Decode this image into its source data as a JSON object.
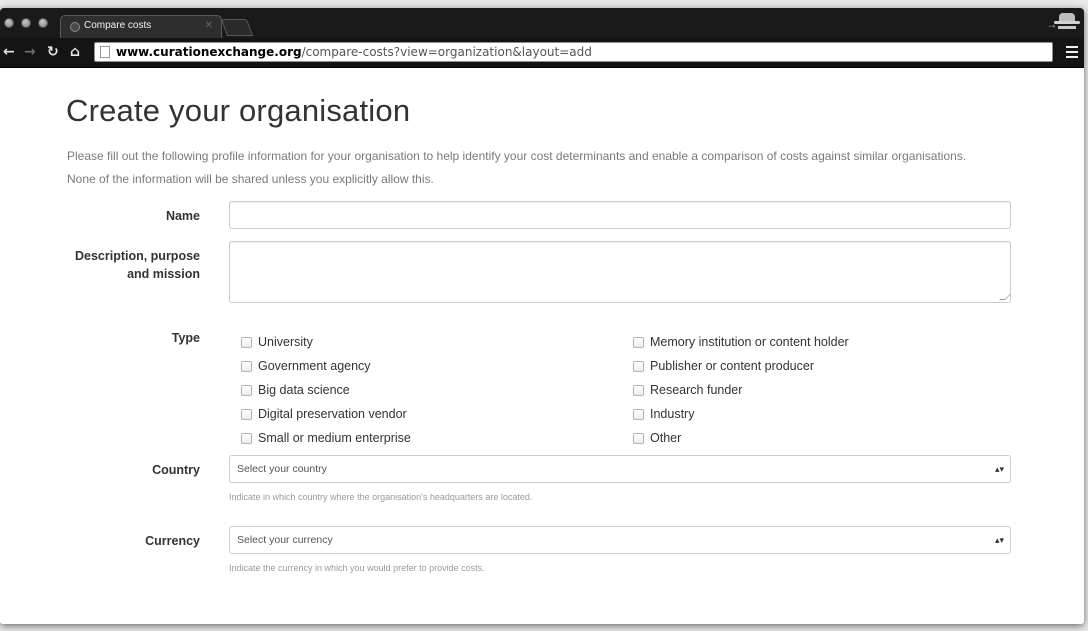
{
  "browser": {
    "tab_title": "Compare costs",
    "url_domain": "www.curationexchange.org",
    "url_path": "/compare-costs?view=organization&layout=add"
  },
  "page": {
    "title": "Create your organisation",
    "intro": "Please fill out the following profile information for your organisation to help identify your cost determinants and enable a comparison of costs against similar organisations. None of the information will be shared unless you explicitly allow this."
  },
  "form": {
    "name_label": "Name",
    "name_value": "",
    "description_label_line1": "Description, purpose",
    "description_label_line2": "and mission",
    "description_value": "",
    "type_label": "Type",
    "types_left": [
      "University",
      "Government agency",
      "Big data science",
      "Digital preservation vendor",
      "Small or medium enterprise"
    ],
    "types_right": [
      "Memory institution or content holder",
      "Publisher or content producer",
      "Research funder",
      "Industry",
      "Other"
    ],
    "country_label": "Country",
    "country_select": "Select your country",
    "country_help": "Indicate in which country where the organisation's headquarters are located.",
    "currency_label": "Currency",
    "currency_select": "Select your currency",
    "currency_help": "Indicate the currency in which you would prefer to provide costs."
  }
}
